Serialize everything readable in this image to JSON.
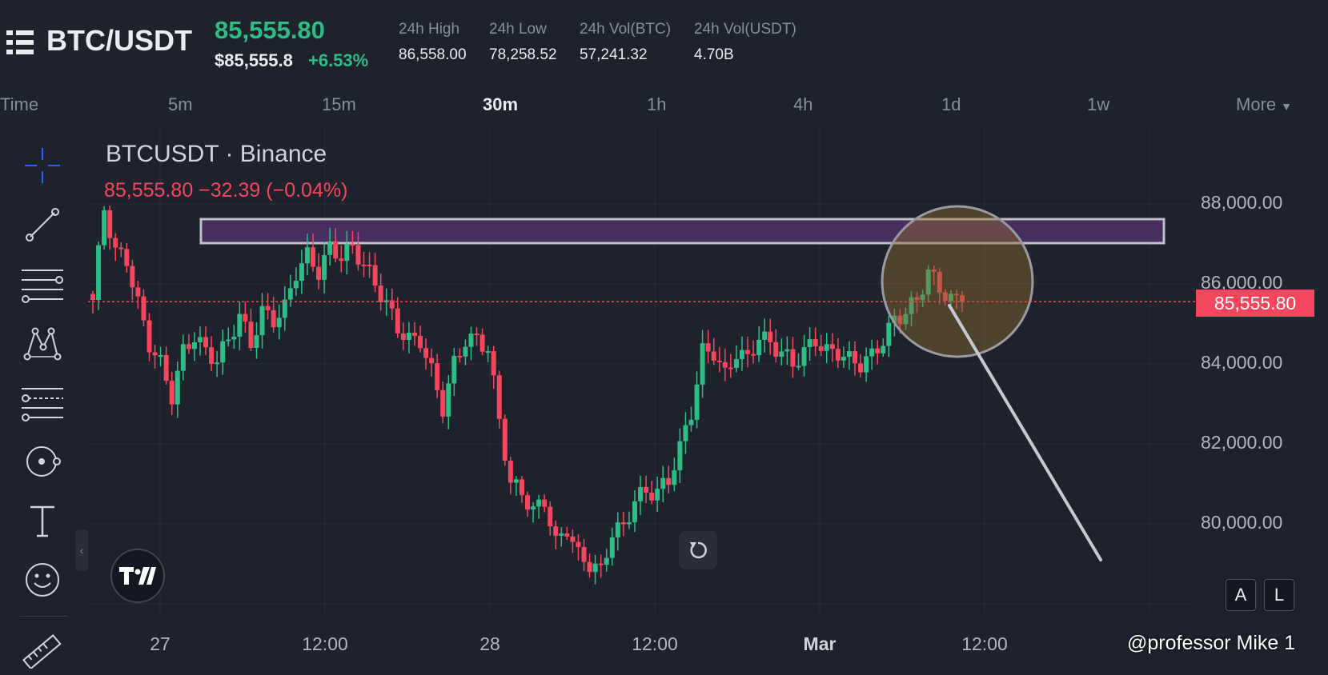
{
  "header": {
    "pair": "BTC/USDT",
    "last_price": "85,555.80",
    "usd_price": "$85,555.8",
    "change_pct": "+6.53%",
    "stats": [
      {
        "label": "24h High",
        "value": "86,558.00"
      },
      {
        "label": "24h Low",
        "value": "78,258.52"
      },
      {
        "label": "24h Vol(BTC)",
        "value": "57,241.32"
      },
      {
        "label": "24h Vol(USDT)",
        "value": "4.70B"
      }
    ]
  },
  "timeframes": {
    "items": [
      "Time",
      "5m",
      "15m",
      "30m",
      "1h",
      "4h",
      "1d",
      "1w"
    ],
    "active": "30m",
    "more_label": "More"
  },
  "toolbar": {
    "icons": [
      "crosshair-icon",
      "trend-line-icon",
      "parallel-lines-icon",
      "pattern-icon",
      "fib-retracement-icon",
      "circle-brush-icon",
      "text-tool-icon",
      "emoji-icon",
      "ruler-icon"
    ]
  },
  "chart": {
    "symbol_title": "BTCUSDT · Binance",
    "ohlc_text": "85,555.80  −32.39 (−0.04%)",
    "current_price_tag": "85,555.80",
    "price_axis_labels": [
      "88,000.00",
      "86,000.00",
      "84,000.00",
      "82,000.00",
      "80,000.00"
    ],
    "time_axis_labels": [
      "27",
      "12:00",
      "28",
      "12:00",
      "Mar",
      "12:00"
    ],
    "scale_buttons": [
      "A",
      "L"
    ],
    "watermark": "@professor Mike 1",
    "colors": {
      "up": "#2ebd85",
      "down": "#f6465d",
      "background": "#1e222d",
      "resistance_zone": "#4a2e63",
      "highlight_circle": "#8b6a2e"
    }
  },
  "chart_data": {
    "type": "candlestick",
    "symbol": "BTCUSDT",
    "interval": "30m",
    "y_unit": "USDT",
    "ylim": [
      78500,
      89000
    ],
    "x_ticks": [
      "27",
      "12:00",
      "28",
      "12:00",
      "Mar",
      "12:00"
    ],
    "close_path": [
      85600,
      87900,
      86800,
      86600,
      85500,
      84500,
      84000,
      83200,
      84300,
      84700,
      84300,
      84100,
      84600,
      85200,
      84500,
      85300,
      85100,
      85400,
      86300,
      86700,
      86300,
      86900,
      86700,
      86900,
      86500,
      86000,
      85500,
      84900,
      84600,
      84600,
      83800,
      82900,
      84000,
      84600,
      84600,
      84400,
      82600,
      81000,
      80800,
      80300,
      80600,
      79500,
      79900,
      79200,
      79000,
      78800,
      79800,
      79900,
      80600,
      80800,
      80800,
      81100,
      81900,
      82800,
      84300,
      84300,
      83700,
      84300,
      84100,
      84700,
      84500,
      84300,
      84000,
      84300,
      84600,
      84300,
      84300,
      84100,
      84000,
      84200,
      84600,
      85100,
      85300,
      85600,
      86300,
      85900,
      85600,
      85555.8
    ],
    "current_price": 85555.8,
    "annotations": {
      "resistance_zone": [
        87000,
        87600
      ],
      "highlighted_area": "recent-high"
    }
  }
}
